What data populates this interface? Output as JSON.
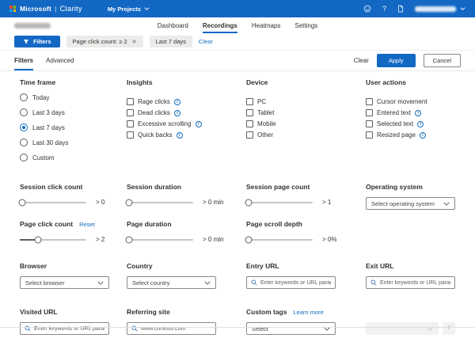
{
  "header": {
    "microsoft": "Microsoft",
    "pipe": "|",
    "product": "Clarity",
    "projects_menu_label": "My Projects",
    "help_glyph": "?"
  },
  "nav": {
    "tabs": [
      {
        "label": "Dashboard",
        "active": false
      },
      {
        "label": "Recordings",
        "active": true
      },
      {
        "label": "Heatmaps",
        "active": false
      },
      {
        "label": "Settings",
        "active": false
      }
    ]
  },
  "filter_bar": {
    "filters_button_label": "Filters",
    "chips": [
      {
        "label": "Page click count: ≥  2",
        "removable": true
      },
      {
        "label": "Last 7 days",
        "removable": false
      }
    ],
    "clear_label": "Clear",
    "close_glyph": "✕"
  },
  "panel_header": {
    "tabs": [
      {
        "label": "Filters",
        "active": true
      },
      {
        "label": "Advanced",
        "active": false
      }
    ],
    "clear_label": "Clear",
    "apply_label": "Apply",
    "cancel_label": "Cancel"
  },
  "time_frame": {
    "label": "Time frame",
    "options": [
      {
        "label": "Today",
        "selected": false
      },
      {
        "label": "Last 3 days",
        "selected": false
      },
      {
        "label": "Last 7 days",
        "selected": true
      },
      {
        "label": "Last 30 days",
        "selected": false
      },
      {
        "label": "Custom",
        "selected": false
      }
    ]
  },
  "insights": {
    "label": "Insights",
    "options": [
      {
        "label": "Rage clicks",
        "info": true,
        "checked": false
      },
      {
        "label": "Dead clicks",
        "info": true,
        "checked": false
      },
      {
        "label": "Excessive scrolling",
        "info": true,
        "checked": false
      },
      {
        "label": "Quick backs",
        "info": true,
        "checked": false
      }
    ]
  },
  "device": {
    "label": "Device",
    "options": [
      {
        "label": "PC",
        "checked": false
      },
      {
        "label": "Tablet",
        "checked": false
      },
      {
        "label": "Mobile",
        "checked": false
      },
      {
        "label": "Other",
        "checked": false
      }
    ]
  },
  "user_actions": {
    "label": "User actions",
    "options": [
      {
        "label": "Cursor movement",
        "info": false,
        "checked": false
      },
      {
        "label": "Entered text",
        "info": true,
        "checked": false
      },
      {
        "label": "Selected text",
        "info": true,
        "checked": false
      },
      {
        "label": "Resized page",
        "info": true,
        "checked": false
      }
    ]
  },
  "sliders": {
    "session_click_count": {
      "label": "Session click count",
      "value": "> 0",
      "percent": 0
    },
    "session_duration": {
      "label": "Session duration",
      "value": "> 0 min",
      "percent": 0
    },
    "session_page_count": {
      "label": "Session page count",
      "value": "> 1",
      "percent": 0
    },
    "page_click_count": {
      "label": "Page click count",
      "reset_label": "Reset",
      "value": "> 2",
      "percent": 27
    },
    "page_duration": {
      "label": "Page duration",
      "value": "> 0 min",
      "percent": 0
    },
    "page_scroll_depth": {
      "label": "Page scroll depth",
      "value": "> 0%",
      "percent": 0
    }
  },
  "operating_system": {
    "label": "Operating system",
    "placeholder": "Select operating system"
  },
  "browser": {
    "label": "Browser",
    "placeholder": "Select browser"
  },
  "country": {
    "label": "Country",
    "placeholder": "Select country"
  },
  "entry_url": {
    "label": "Entry URL",
    "placeholder": "Enter keywords or URL parameters"
  },
  "exit_url": {
    "label": "Exit URL",
    "placeholder": "Enter keywords or URL parameters"
  },
  "visited_url": {
    "label": "Visited URL",
    "placeholder": "Enter keywords or URL parameters"
  },
  "referring_site": {
    "label": "Referring site",
    "placeholder": "www.contoso.com"
  },
  "custom_tags": {
    "label": "Custom tags",
    "learn_more_label": "Learn more",
    "placeholder": "Select",
    "plus_glyph": "+"
  },
  "info_glyph": "i",
  "colors": {
    "header_blue": "#1368c4",
    "accent_blue": "#0f6cbd",
    "chip_bg": "#edebe9"
  }
}
